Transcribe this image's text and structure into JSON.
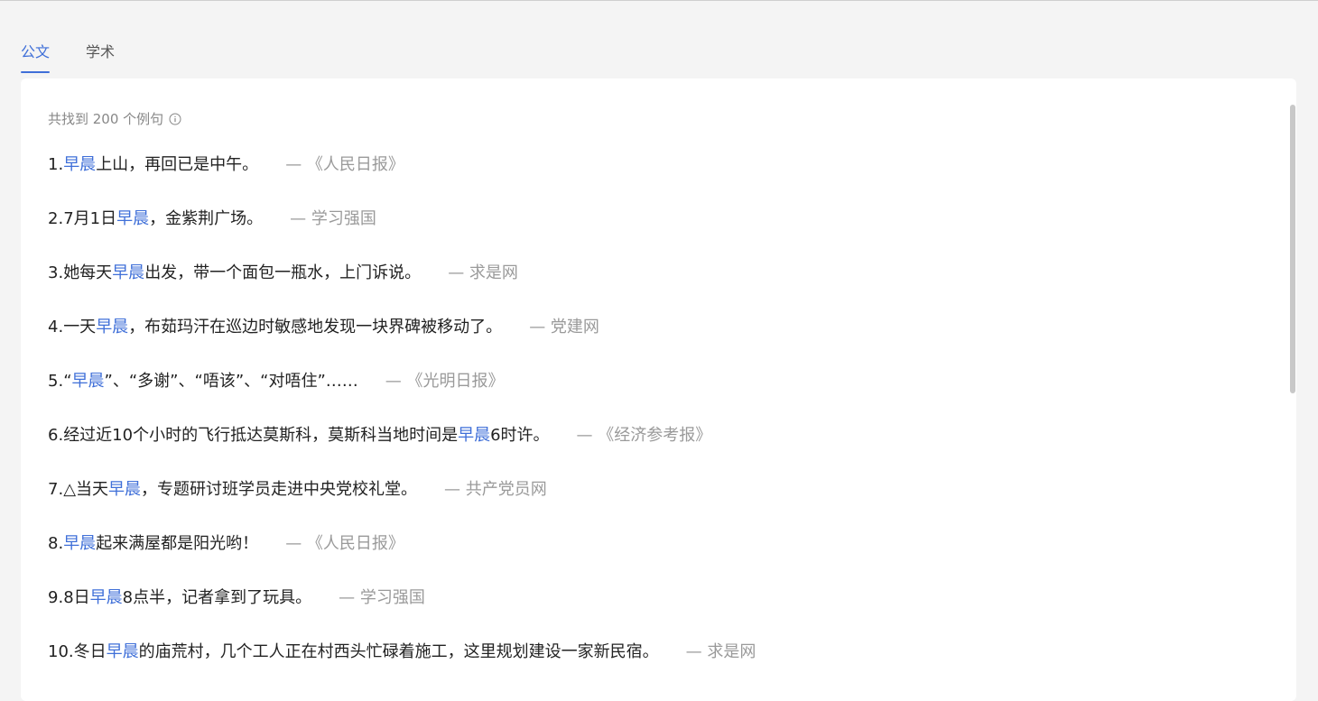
{
  "tabs": [
    {
      "label": "公文",
      "active": true
    },
    {
      "label": "学术",
      "active": false
    }
  ],
  "summary": "共找到 200 个例句",
  "sentences": [
    {
      "num": "1.",
      "pre": "",
      "kw": "早晨",
      "post": "上山，再回已是中午。",
      "source": "— 《人民日报》"
    },
    {
      "num": "2.",
      "pre": "7月1日",
      "kw": "早晨",
      "post": "，金紫荆广场。",
      "source": "— 学习强国"
    },
    {
      "num": "3.",
      "pre": "她每天",
      "kw": "早晨",
      "post": "出发，带一个面包一瓶水，上门诉说。",
      "source": "— 求是网"
    },
    {
      "num": "4.",
      "pre": "一天",
      "kw": "早晨",
      "post": "，布茹玛汗在巡边时敏感地发现一块界碑被移动了。",
      "source": "— 党建网"
    },
    {
      "num": "5.",
      "pre": "“",
      "kw": "早晨",
      "post": "”、“多谢”、“唔该”、“对唔住”……",
      "source": "— 《光明日报》"
    },
    {
      "num": "6.",
      "pre": "经过近10个小时的飞行抵达莫斯科，莫斯科当地时间是",
      "kw": "早晨",
      "post": "6时许。",
      "source": "— 《经济参考报》"
    },
    {
      "num": "7.",
      "pre": "△当天",
      "kw": "早晨",
      "post": "，专题研讨班学员走进中央党校礼堂。",
      "source": "— 共产党员网"
    },
    {
      "num": "8.",
      "pre": "",
      "kw": "早晨",
      "post": "起来满屋都是阳光哟！",
      "source": "— 《人民日报》"
    },
    {
      "num": "9.",
      "pre": "8日",
      "kw": "早晨",
      "post": "8点半，记者拿到了玩具。",
      "source": "— 学习强国"
    },
    {
      "num": "10.",
      "pre": "冬日",
      "kw": "早晨",
      "post": "的庙荒村，几个工人正在村西头忙碌着施工，这里规划建设一家新民宿。",
      "source": "— 求是网"
    }
  ],
  "colors": {
    "accent": "#3f6fd8",
    "source": "#9a9a9a",
    "background": "#f4f4f4"
  },
  "icons": {
    "summary_icon": "info-icon"
  }
}
